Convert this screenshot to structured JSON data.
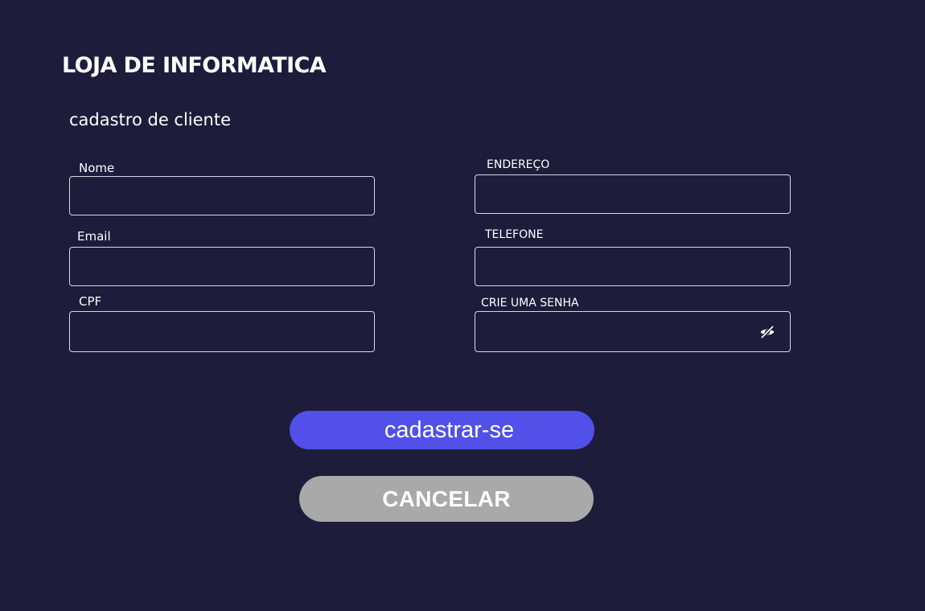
{
  "header": {
    "title": "LOJA DE INFORMATICA",
    "subtitle": "cadastro de cliente"
  },
  "form": {
    "fields": [
      {
        "label": "Nome",
        "value": "",
        "placeholder": ""
      },
      {
        "label": "Email",
        "value": "",
        "placeholder": ""
      },
      {
        "label": "CPF",
        "value": "",
        "placeholder": ""
      },
      {
        "label": "ENDEREÇO",
        "value": "",
        "placeholder": ""
      },
      {
        "label": "TELEFONE",
        "value": "",
        "placeholder": ""
      },
      {
        "label": "CRIE UMA SENHA",
        "value": "",
        "placeholder": "",
        "icon": "eye-off-icon"
      }
    ]
  },
  "actions": {
    "submit_label": "cadastrar-se",
    "cancel_label": "CANCELAR"
  },
  "colors": {
    "background": "#1e1c3b",
    "primary": "#5150e8",
    "cancel": "#a9a9a9",
    "border": "#d8d8e0"
  }
}
